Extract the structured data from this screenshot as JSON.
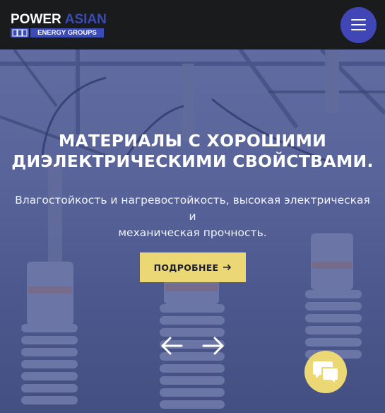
{
  "header": {
    "logo_power": "POWER",
    "logo_asian": "ASIAN",
    "logo_sub": "ENERGY GROUPS",
    "menu_icon": "hamburger-menu-icon"
  },
  "hero": {
    "title_line1": "МАТЕРИАЛЫ С ХОРОШИМИ",
    "title_line2": "ДИЭЛЕКТРИЧЕСКИМИ СВОЙСТВАМИ.",
    "subtitle_line1": "Влагостойкость и нагревостойкость, высокая электрическая и",
    "subtitle_line2": "механическая прочность.",
    "cta_label": "ПОДРОБНЕЕ",
    "cta_icon": "arrow-right-icon",
    "prev_icon": "arrow-left-icon",
    "next_icon": "arrow-right-icon"
  },
  "chat": {
    "icon": "chat-bubbles-icon"
  },
  "colors": {
    "header_bg": "#191b1c",
    "brand_blue": "#3b4bb8",
    "menu_button": "#4146b6",
    "accent_yellow": "#ecd775",
    "hero_tint": "#5d6a9c"
  }
}
